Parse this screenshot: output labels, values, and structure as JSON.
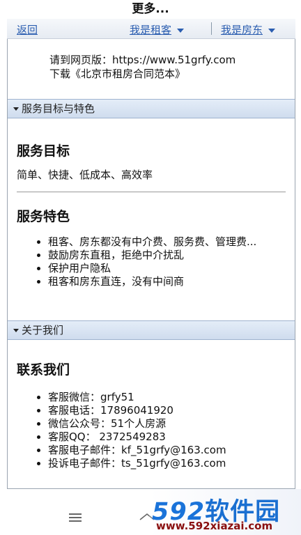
{
  "header": {
    "title": "更多..."
  },
  "nav": {
    "back": "返回",
    "tenant": "我是租客",
    "landlord": "我是房东"
  },
  "intro": {
    "line1": "请到网页版：https://www.51grfy.com",
    "line2": "下载《北京市租房合同范本》"
  },
  "section1": {
    "header": "服务目标与特色",
    "goal_title": "服务目标",
    "goal_text": "简单、快捷、低成本、高效率",
    "feature_title": "服务特色",
    "features": [
      "租客、房东都没有中介费、服务费、管理费...",
      "鼓励房东直租，拒绝中介扰乱",
      "保护用户隐私",
      "租客和房东直连，没有中间商"
    ]
  },
  "section2": {
    "header": "关于我们",
    "contact_title": "联系我们",
    "contacts": [
      "客服微信：grfy51",
      "客服电话：17896041920",
      "微信公众号：51个人房源",
      "客服QQ：  2372549283",
      "客服电子邮件：kf_51grfy@163.com",
      "投诉电子邮件：ts_51grfy@163.com"
    ]
  },
  "watermark": {
    "logo_num": "592",
    "logo_cn": "软件园",
    "url": "www.592xiazai.com"
  },
  "colors": {
    "link": "#2a5db0",
    "section_bg": "#dbe5f2",
    "watermark": "#1a73d9"
  }
}
